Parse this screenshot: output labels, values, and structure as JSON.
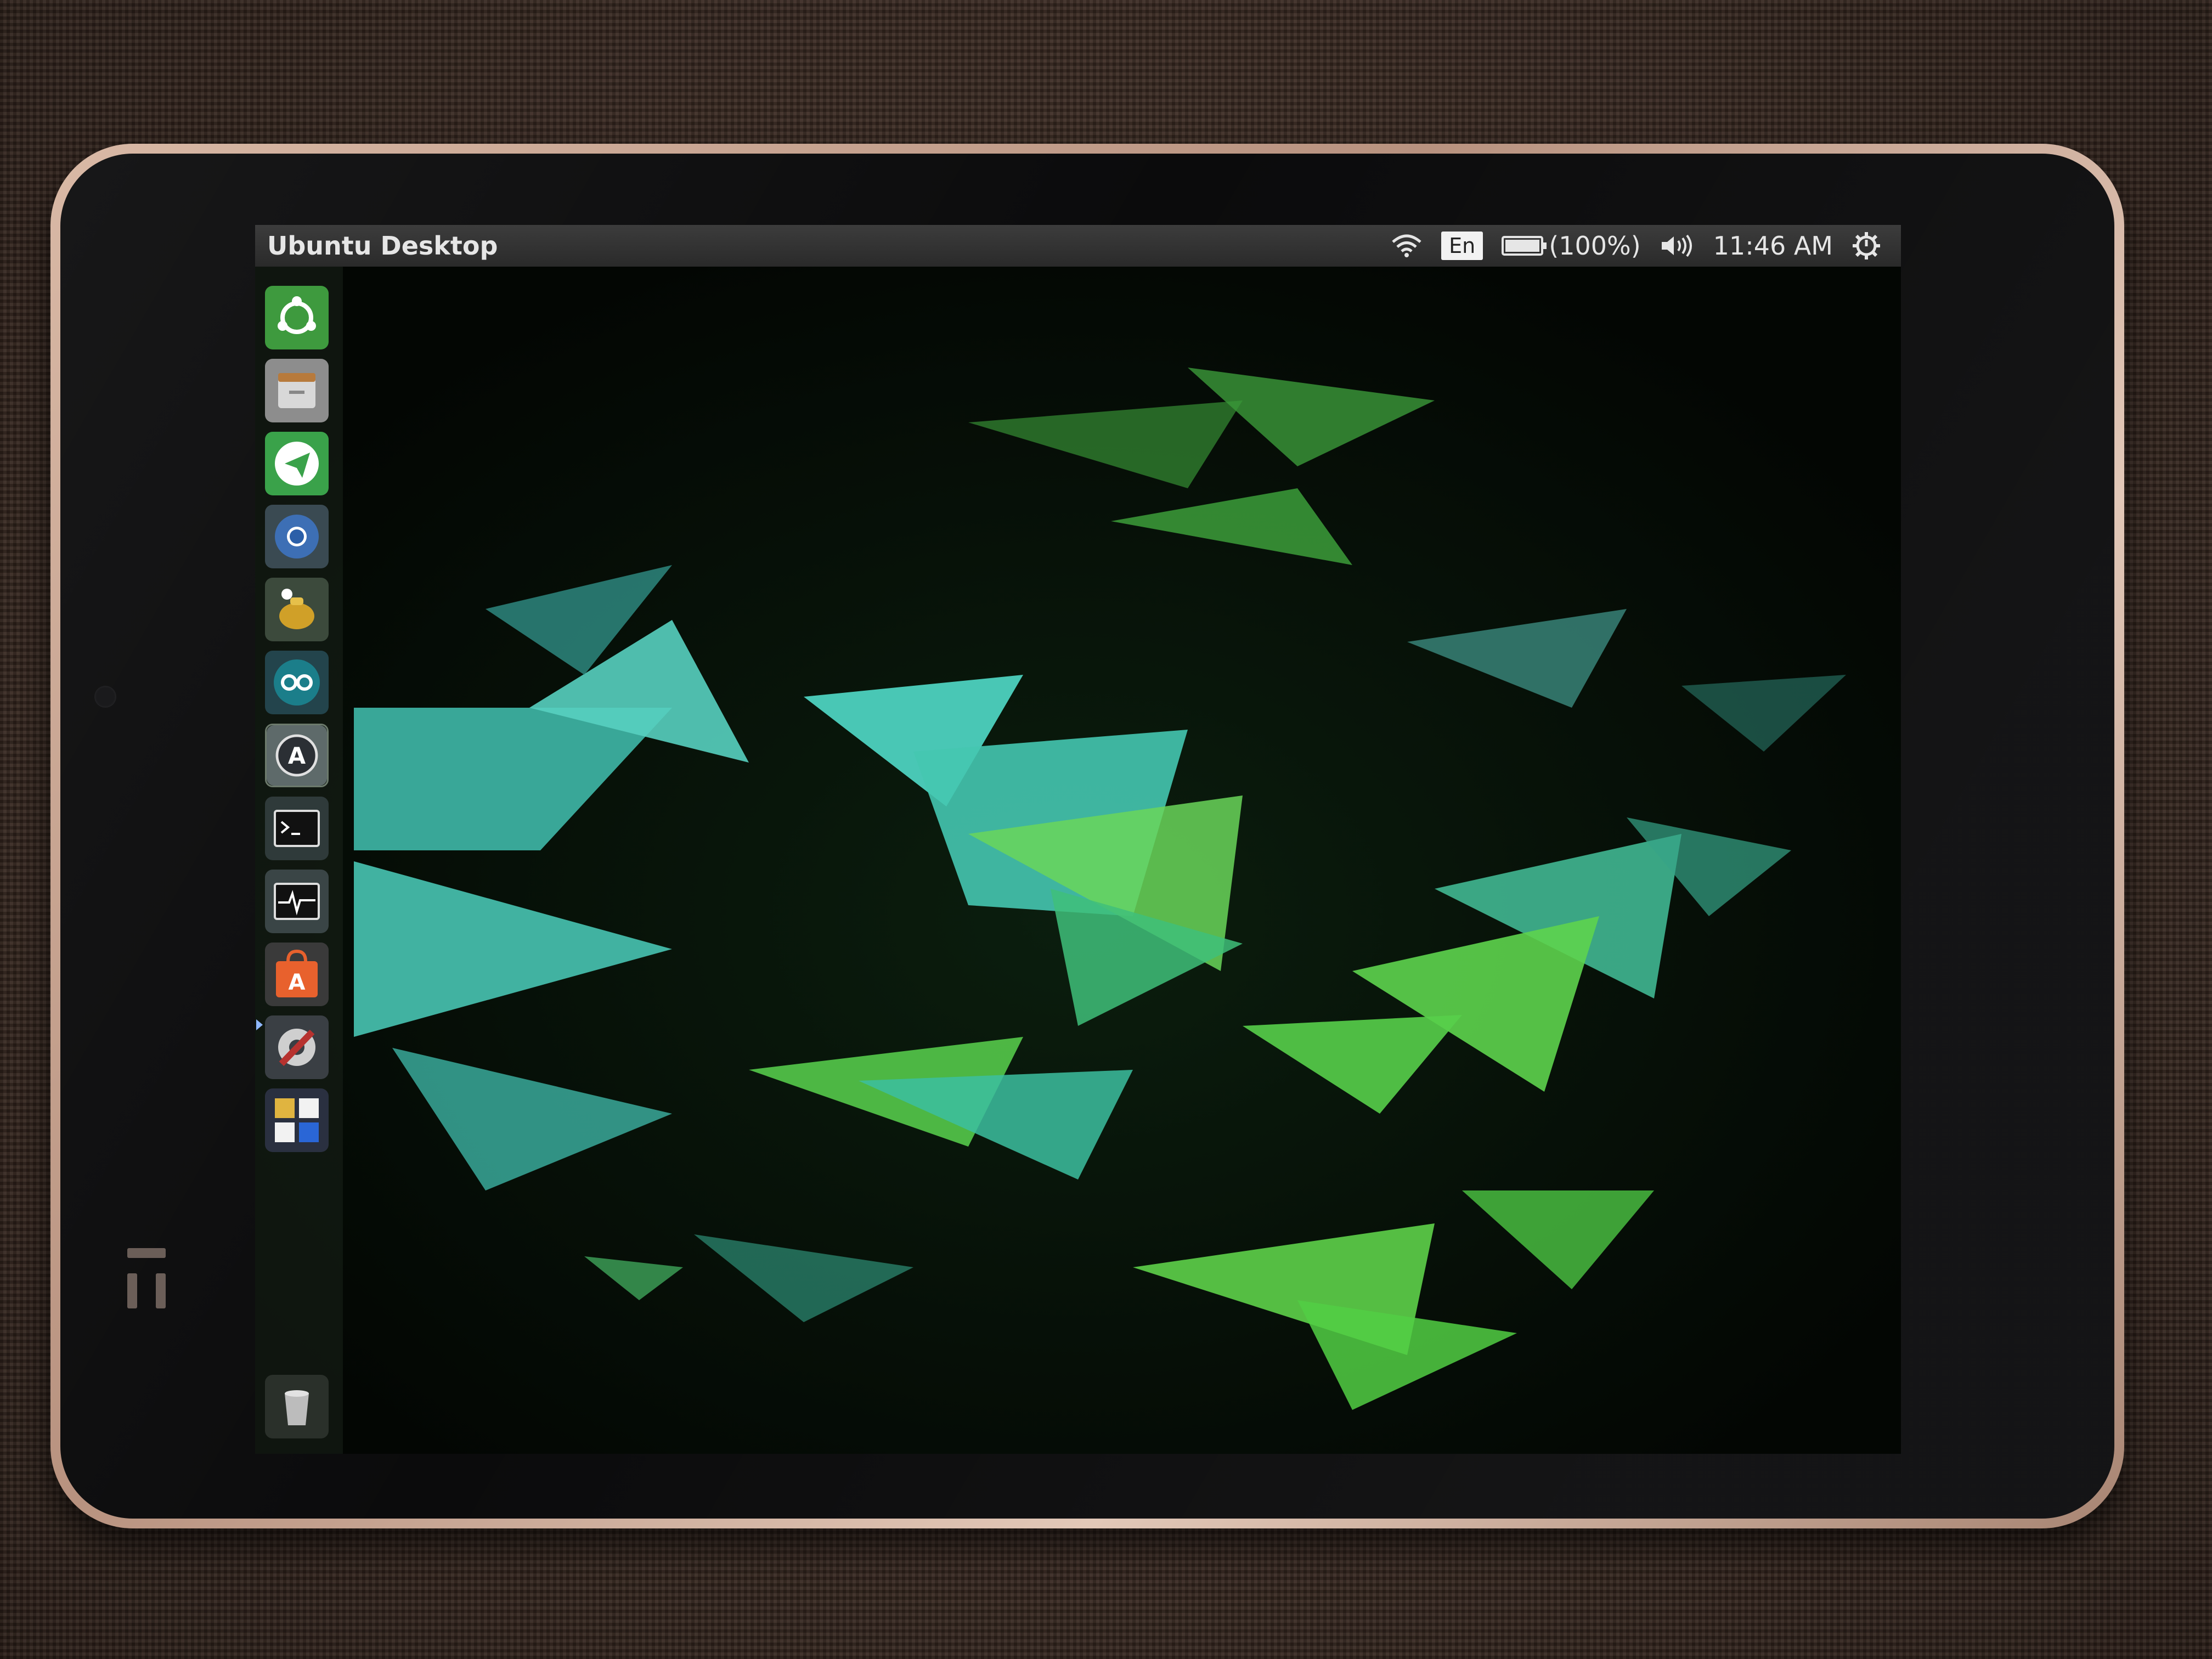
{
  "topbar": {
    "title": "Ubuntu Desktop",
    "language": "En",
    "battery_text": "(100%)",
    "battery_level": 1.0,
    "time": "11:46 AM"
  },
  "indicators": [
    {
      "icon": "wifi-icon"
    },
    {
      "icon": "language-indicator"
    },
    {
      "icon": "battery-icon"
    },
    {
      "icon": "volume-icon"
    },
    {
      "icon": "clock"
    },
    {
      "icon": "power-gear-icon"
    }
  ],
  "launcher": {
    "items": [
      {
        "name": "dash-home",
        "icon": "ubuntu-logo-icon",
        "color": "#3e9a3e"
      },
      {
        "name": "files",
        "icon": "file-cabinet-icon",
        "color": "#8d8d8d"
      },
      {
        "name": "telegram",
        "icon": "paper-plane-icon",
        "color": "#3aa24a"
      },
      {
        "name": "chromium",
        "icon": "chromium-icon",
        "color": "#3d6fb5"
      },
      {
        "name": "teapot-app",
        "icon": "teapot-icon",
        "color": "#d0a028"
      },
      {
        "name": "arduino",
        "icon": "infinity-icon",
        "color": "#1b7e8a"
      },
      {
        "name": "software-updater",
        "icon": "updater-icon",
        "color": "#5e6a6a"
      },
      {
        "name": "terminal",
        "icon": "terminal-icon",
        "color": "#2f3a3a"
      },
      {
        "name": "system-monitor",
        "icon": "system-monitor-icon",
        "color": "#3a4546"
      },
      {
        "name": "ubuntu-software",
        "icon": "shopping-bag-icon",
        "color": "#e8612d"
      },
      {
        "name": "system-settings",
        "icon": "settings-wrench-icon",
        "color": "#b7322f"
      },
      {
        "name": "workspace-switcher",
        "icon": "workspaces-icon",
        "color": "#2a3040"
      }
    ],
    "trash": {
      "icon": "trash-icon"
    }
  }
}
